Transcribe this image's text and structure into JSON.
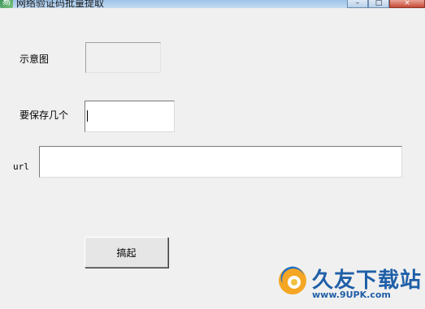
{
  "window": {
    "title": "网络验证码批量提取",
    "app_icon_glyph": "易",
    "controls": {
      "minimize": "–",
      "maximize": "□",
      "close": "×"
    }
  },
  "form": {
    "preview_label": "示意图",
    "count_label": "要保存几个",
    "count_value": "",
    "url_label": "url",
    "url_value": "",
    "submit_label": "搞起"
  },
  "watermark": {
    "brand": "久友下载站",
    "url": "www.9UPK.com",
    "brand_color": "#1f5fa8"
  }
}
